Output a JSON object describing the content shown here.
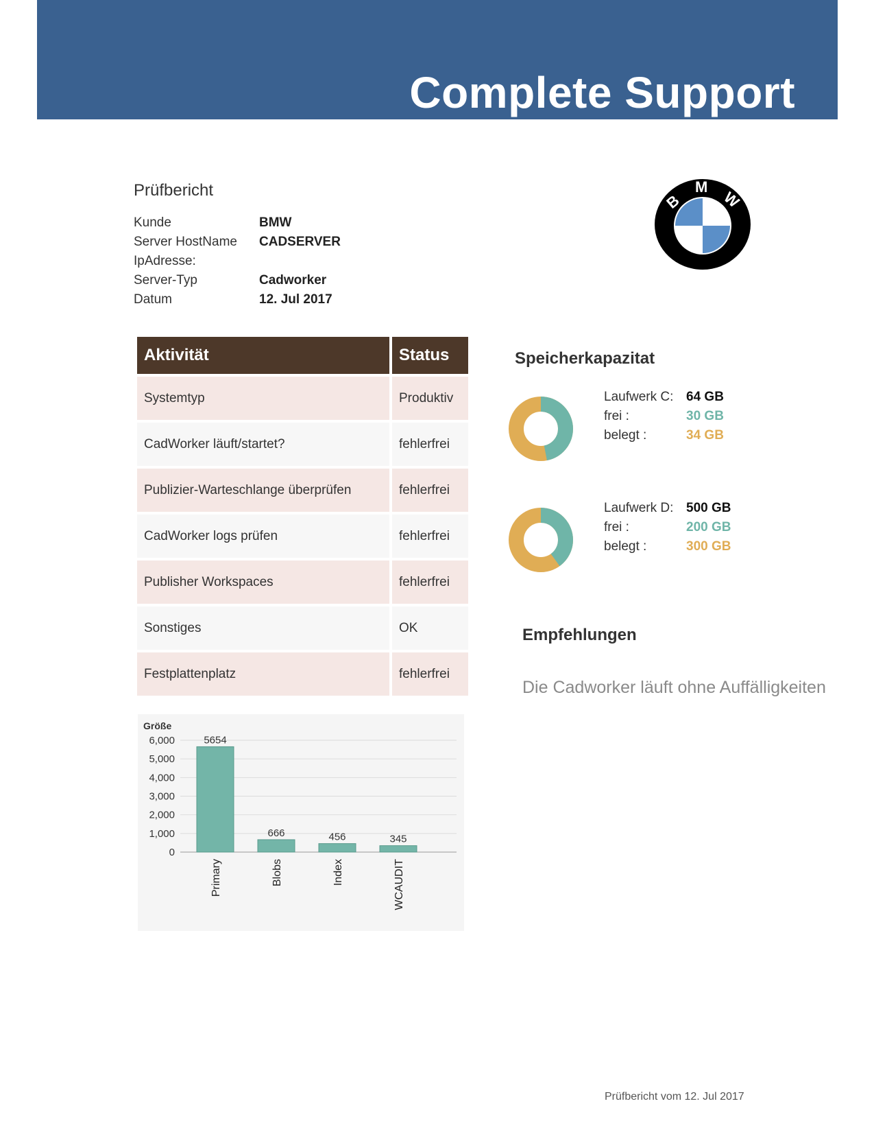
{
  "banner": {
    "title": "Complete Support"
  },
  "doc": {
    "heading": "Prüfbericht",
    "info": [
      {
        "label": "Kunde",
        "value": "BMW"
      },
      {
        "label": "Server HostName",
        "value": "CADSERVER"
      },
      {
        "label": "IpAdresse:",
        "value": ""
      },
      {
        "label": "Server-Typ",
        "value": "Cadworker"
      },
      {
        "label": "Datum",
        "value": "12. Jul 2017"
      }
    ]
  },
  "logo": {
    "letters": [
      "B",
      "M",
      "W"
    ],
    "colors": {
      "ring": "#000000",
      "blue": "#5b8fc8",
      "white": "#ffffff"
    }
  },
  "activities": {
    "headers": {
      "activity": "Aktivität",
      "status": "Status"
    },
    "rows": [
      {
        "activity": "Systemtyp",
        "status": "Produktiv",
        "ok": false
      },
      {
        "activity": "CadWorker läuft/startet?",
        "status": "fehlerfrei",
        "ok": true
      },
      {
        "activity": "Publizier-Warteschlange überprüfen",
        "status": "fehlerfrei",
        "ok": true
      },
      {
        "activity": "CadWorker logs prüfen",
        "status": "fehlerfrei",
        "ok": true
      },
      {
        "activity": "Publisher Workspaces",
        "status": "fehlerfrei",
        "ok": true
      },
      {
        "activity": "Sonstiges",
        "status": "OK",
        "ok": false
      },
      {
        "activity": "Festplattenplatz",
        "status": "fehlerfrei",
        "ok": true
      }
    ]
  },
  "chart_data": {
    "type": "bar",
    "title": "Größe",
    "xlabel": "",
    "ylabel": "",
    "categories": [
      "Primary",
      "Blobs",
      "Index",
      "WCAUDIT"
    ],
    "values": [
      5654,
      666,
      456,
      345
    ],
    "ylim": [
      0,
      6000
    ],
    "yticks": [
      "0",
      "1,000",
      "2,000",
      "3,000",
      "4,000",
      "5,000",
      "6,000"
    ],
    "grid": true,
    "color": "#73b5a8"
  },
  "storage": {
    "title": "Speicherkapazitat",
    "colors": {
      "free": "#6fb5a8",
      "used": "#e0ad55"
    },
    "drives": [
      {
        "label": "Laufwerk C:",
        "total": "64 GB",
        "free_label": "frei :",
        "free": "30 GB",
        "used_label": "belegt :",
        "used": "34 GB",
        "free_gb": 30,
        "used_gb": 34
      },
      {
        "label": "Laufwerk D:",
        "total": "500 GB",
        "free_label": "frei :",
        "free": "200 GB",
        "used_label": "belegt :",
        "used": "300 GB",
        "free_gb": 200,
        "used_gb": 300
      }
    ]
  },
  "recommendations": {
    "title": "Empfehlungen",
    "text": "Die Cadworker läuft ohne Auffälligkeiten"
  },
  "footer": {
    "text": "Prüfbericht vom 12. Jul 2017"
  }
}
